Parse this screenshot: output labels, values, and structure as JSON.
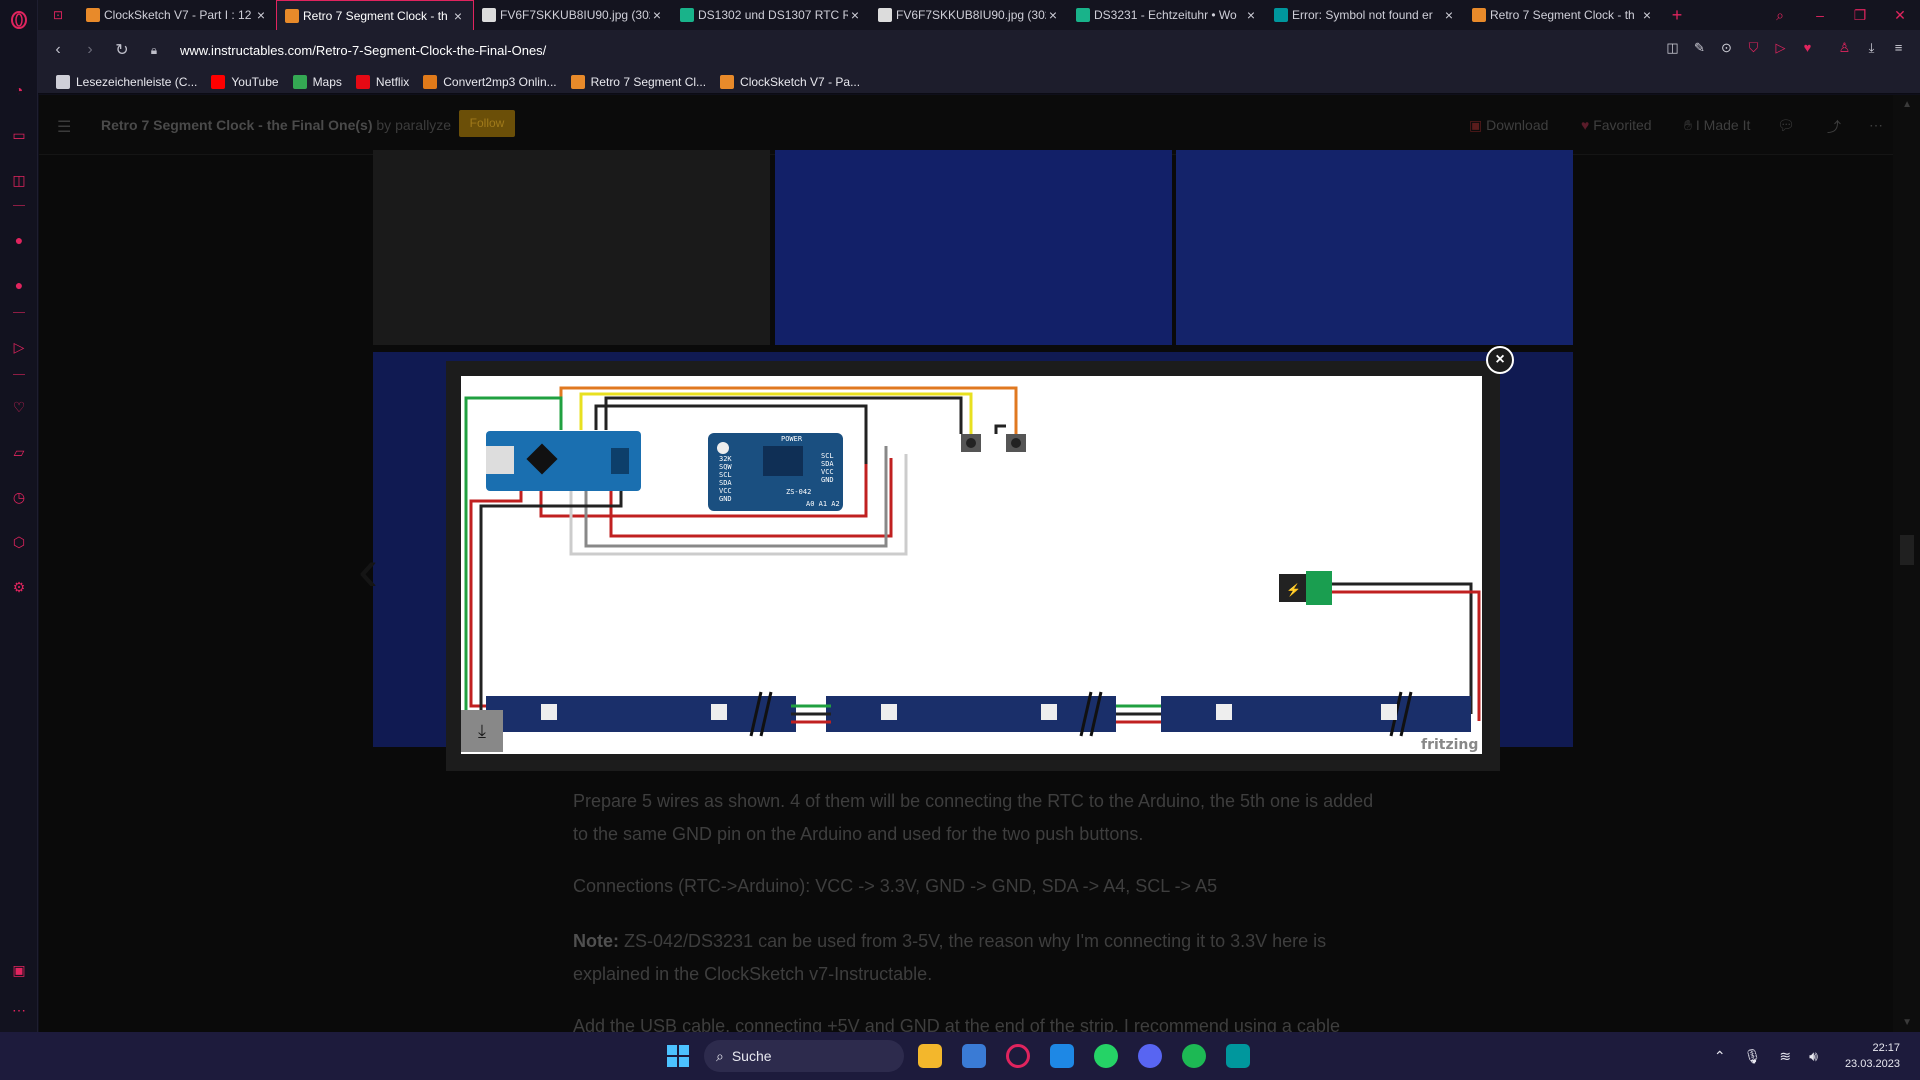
{
  "tabs": [
    {
      "title": "ClockSketch V7 - Part I : 12",
      "fav": "#e88a2a",
      "active": false
    },
    {
      "title": "Retro 7 Segment Clock - th",
      "fav": "#e88a2a",
      "active": true
    },
    {
      "title": "FV6F7SKKUB8IU90.jpg (302",
      "fav": "#dcdcdc",
      "active": false
    },
    {
      "title": "DS1302 und DS1307 RTC R",
      "fav": "#19b38a",
      "active": false
    },
    {
      "title": "FV6F7SKKUB8IU90.jpg (302",
      "fav": "#dcdcdc",
      "active": false
    },
    {
      "title": "DS3231 - Echtzeituhr • Wo",
      "fav": "#19b38a",
      "active": false
    },
    {
      "title": "Error: Symbol not found er",
      "fav": "#00979d",
      "active": false
    },
    {
      "title": "Retro 7 Segment Clock - th",
      "fav": "#e88a2a",
      "active": false
    }
  ],
  "address": {
    "url": "www.instructables.com/Retro-7-Segment-Clock-the-Final-Ones/"
  },
  "bookmarks": [
    {
      "label": "Lesezeichenleiste (C...",
      "color": "#cfcfd8"
    },
    {
      "label": "YouTube",
      "color": "#ff0000"
    },
    {
      "label": "Maps",
      "color": "#34a853"
    },
    {
      "label": "Netflix",
      "color": "#e50914"
    },
    {
      "label": "Convert2mp3 Onlin...",
      "color": "#e07a1a"
    },
    {
      "label": "Retro 7 Segment Cl...",
      "color": "#e88a2a"
    },
    {
      "label": "ClockSketch V7 - Pa...",
      "color": "#e88a2a"
    }
  ],
  "page": {
    "title": "Retro 7 Segment Clock - the Final One(s)",
    "by": "by parallyze",
    "follow": "Follow",
    "download": "Download",
    "favorited": "Favorited",
    "made_it": "I Made It",
    "para1": "Prepare 5 wires as shown. 4 of them will be connecting the RTC to the Arduino, the 5th one is added to the same GND pin on the Arduino and used for the two push buttons.",
    "para2": "Connections (RTC->Arduino): VCC -> 3.3V, GND -> GND, SDA -> A4, SCL -> A5",
    "note_label": "Note:",
    "para3": " ZS-042/DS3231 can be used from 3-5V, the reason why I'm connecting it to 3.3V here is explained in the ClockSketch v7-Instructable.",
    "para4": "Add the USB cable, connecting +5V and GND at the end of the strip. I recommend using a cable"
  },
  "diagram": {
    "rtc_pins": [
      "32K",
      "SQW",
      "SCL",
      "SDA",
      "VCC",
      "GND"
    ],
    "rtc_pins_right": [
      "SCL",
      "SDA",
      "VCC",
      "GND"
    ],
    "rtc_model": "ZS-042",
    "rtc_power": "POWER",
    "rtc_addr": "A0 A1 A2",
    "watermark": "fritzing"
  },
  "taskbar": {
    "search": "Suche",
    "time": "22:17",
    "date": "23.03.2023"
  }
}
